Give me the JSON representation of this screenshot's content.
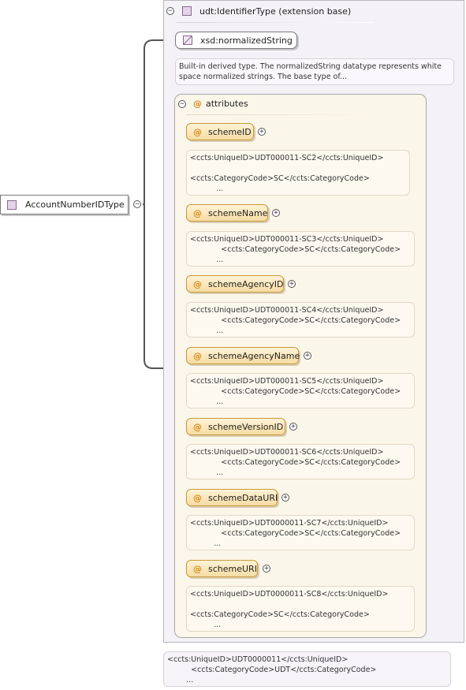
{
  "main_type": {
    "label": "AccountNumberIDType",
    "collapse_symbol": "−"
  },
  "extension": {
    "label": "udt:IdentifierType (extension base)",
    "collapse_symbol": "−"
  },
  "base_type": {
    "label": "xsd:normalizedString",
    "doc": "Built-in derived type. The normalizedString datatype represents white\nspace normalized strings. The base type of..."
  },
  "attributes_group": {
    "label": "attributes",
    "collapse_symbol": "−",
    "at_symbol": "@"
  },
  "attributes": [
    {
      "name": "schemeID",
      "expand_symbol": "+",
      "doc": "<ccts:UniqueID>UDT000011-SC2</ccts:UniqueID>\n\n<ccts:CategoryCode>SC</ccts:CategoryCode>\n           ..."
    },
    {
      "name": "schemeName",
      "expand_symbol": "+",
      "doc": "<ccts:UniqueID>UDT000011-SC3</ccts:UniqueID>\n             <ccts:CategoryCode>SC</ccts:CategoryCode>\n           ..."
    },
    {
      "name": "schemeAgencyID",
      "expand_symbol": "+",
      "doc": "<ccts:UniqueID>UDT000011-SC4</ccts:UniqueID>\n             <ccts:CategoryCode>SC</ccts:CategoryCode>\n           ..."
    },
    {
      "name": "schemeAgencyName",
      "expand_symbol": "+",
      "doc": "<ccts:UniqueID>UDT000011-SC5</ccts:UniqueID>\n             <ccts:CategoryCode>SC</ccts:CategoryCode>\n           ..."
    },
    {
      "name": "schemeVersionID",
      "expand_symbol": "+",
      "doc": "<ccts:UniqueID>UDT000011-SC6</ccts:UniqueID>\n             <ccts:CategoryCode>SC</ccts:CategoryCode>\n           ..."
    },
    {
      "name": "schemeDataURI",
      "expand_symbol": "+",
      "doc": "<ccts:UniqueID>UDT0000011-SC7</ccts:UniqueID>\n             <ccts:CategoryCode>SC</ccts:CategoryCode>\n          ..."
    },
    {
      "name": "schemeURI",
      "expand_symbol": "+",
      "doc": "<ccts:UniqueID>UDT0000011-SC8</ccts:UniqueID>\n\n<ccts:CategoryCode>SC</ccts:CategoryCode>\n          ..."
    }
  ],
  "footer_doc": "<ccts:UniqueID>UDT0000011</ccts:UniqueID>\n          <ccts:CategoryCode>UDT</ccts:CategoryCode>\n        ..."
}
